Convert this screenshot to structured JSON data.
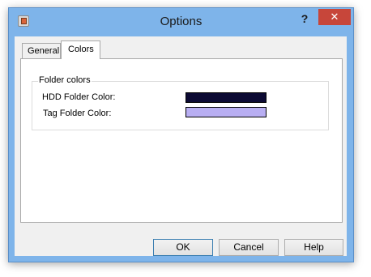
{
  "window": {
    "title": "Options"
  },
  "titlebar": {
    "help_glyph": "?",
    "close_glyph": "✕",
    "app_icon": "options-app-icon"
  },
  "tabs": [
    {
      "label": "General"
    },
    {
      "label": "Colors"
    }
  ],
  "active_tab": "Colors",
  "folder_colors": {
    "group_label": "Folder colors",
    "hdd_label": "HDD Folder Color:",
    "hdd_color": "#0c0a33",
    "tag_label": "Tag Folder Color:",
    "tag_color": "#b8aef2"
  },
  "buttons": {
    "ok": "OK",
    "cancel": "Cancel",
    "help": "Help"
  },
  "colors": {
    "titlebar": "#7eb4ea",
    "close_button": "#c7463a",
    "dialog_bg": "#f0f0f0"
  }
}
